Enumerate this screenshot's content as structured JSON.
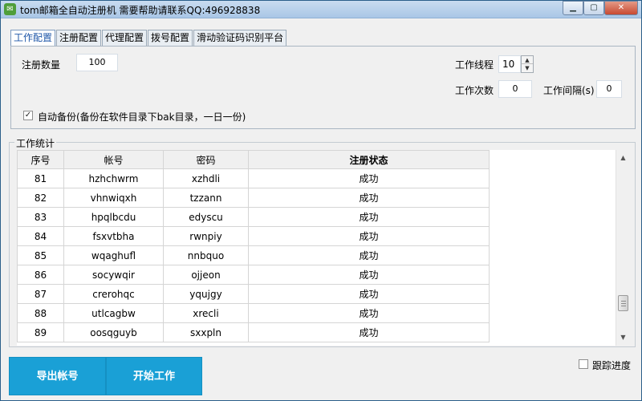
{
  "window": {
    "title": "tom邮箱全自动注册机 需要帮助请联系QQ:496928838",
    "icon": "app-icon",
    "controls": [
      "minimize",
      "maximize",
      "close"
    ]
  },
  "tabs": [
    {
      "label": "工作配置",
      "active": true
    },
    {
      "label": "注册配置",
      "active": false
    },
    {
      "label": "代理配置",
      "active": false
    },
    {
      "label": "拨号配置",
      "active": false
    },
    {
      "label": "滑动验证码识别平台",
      "active": false
    }
  ],
  "config": {
    "register_count_label": "注册数量",
    "register_count_value": "100",
    "threads_label": "工作线程",
    "threads_value": "10",
    "work_times_label": "工作次数",
    "work_times_value": "0",
    "work_interval_label": "工作间隔(s)",
    "work_interval_value": "0",
    "auto_backup_label": "自动备份(备份在软件目录下bak目录，一日一份)",
    "auto_backup_checked": true
  },
  "stats": {
    "group_title": "工作统计",
    "columns": [
      "序号",
      "帐号",
      "密码",
      "注册状态"
    ],
    "rows": [
      [
        "81",
        "hzhchwrm",
        "xzhdli",
        "成功"
      ],
      [
        "82",
        "vhnwiqxh",
        "tzzann",
        "成功"
      ],
      [
        "83",
        "hpqlbcdu",
        "edyscu",
        "成功"
      ],
      [
        "84",
        "fsxvtbha",
        "rwnpiy",
        "成功"
      ],
      [
        "85",
        "wqaghufl",
        "nnbquo",
        "成功"
      ],
      [
        "86",
        "socywqir",
        "ojjeon",
        "成功"
      ],
      [
        "87",
        "crerohqc",
        "yqujgy",
        "成功"
      ],
      [
        "88",
        "utlcagbw",
        "xrecli",
        "成功"
      ],
      [
        "89",
        "oosqguyb",
        "sxxpln",
        "成功"
      ]
    ]
  },
  "actions": {
    "export_label": "导出帐号",
    "start_label": "开始工作",
    "track_progress_label": "跟踪进度",
    "track_progress_checked": false
  },
  "colors": {
    "action_button": "#1aa0d6",
    "active_tab_text": "#1f57a8",
    "title_bar": "#b9d1ec"
  }
}
